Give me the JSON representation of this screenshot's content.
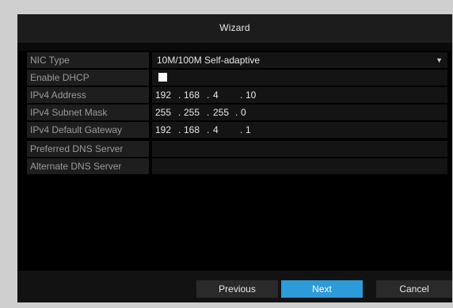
{
  "window": {
    "title": "Wizard"
  },
  "form": {
    "nic_type": {
      "label": "NIC Type",
      "value": "10M/100M Self-adaptive"
    },
    "enable_dhcp": {
      "label": "Enable DHCP",
      "checked": false
    },
    "ipv4_address": {
      "label": "IPv4 Address",
      "octets": [
        "192",
        "168",
        "4",
        "10"
      ]
    },
    "ipv4_subnet_mask": {
      "label": "IPv4 Subnet Mask",
      "octets": [
        "255",
        "255",
        "255",
        "0"
      ]
    },
    "ipv4_default_gateway": {
      "label": "IPv4 Default Gateway",
      "octets": [
        "192",
        "168",
        "4",
        "1"
      ]
    },
    "preferred_dns": {
      "label": "Preferred DNS Server",
      "value": ""
    },
    "alternate_dns": {
      "label": "Alternate DNS Server",
      "value": ""
    }
  },
  "footer": {
    "previous_label": "Previous",
    "next_label": "Next",
    "cancel_label": "Cancel"
  },
  "colors": {
    "accent": "#2d9ad9",
    "background": "#000000",
    "label_bg": "#1e1e1e"
  },
  "icons": {
    "dropdown": "chevron-down-icon"
  }
}
